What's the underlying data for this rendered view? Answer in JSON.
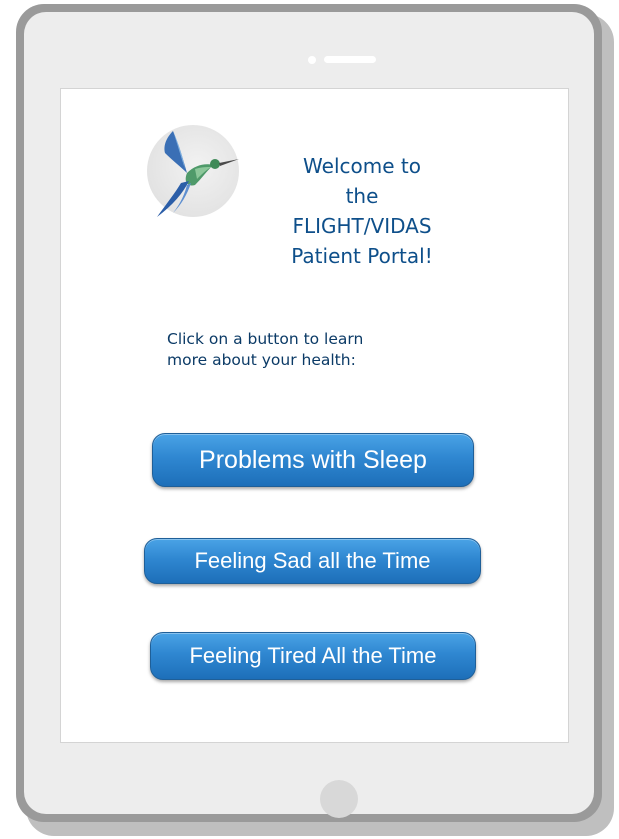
{
  "portal": {
    "welcome_lines": [
      "Welcome to",
      "the",
      "FLIGHT/VIDAS",
      "Patient Portal!"
    ],
    "prompt_lines": [
      "Click on a button to learn",
      "more about your health:"
    ],
    "logo_icon": "hummingbird-icon"
  },
  "buttons": {
    "sleep_label": "Problems with Sleep",
    "sad_label": "Feeling Sad all the Time",
    "tired_label": "Feeling Tired All the Time"
  },
  "colors": {
    "heading": "#0e4f8a",
    "button_top": "#4aa3e6",
    "button_bottom": "#1d6fb9",
    "tablet_frame": "#9a9a9a",
    "tablet_bezel": "#ededed"
  }
}
